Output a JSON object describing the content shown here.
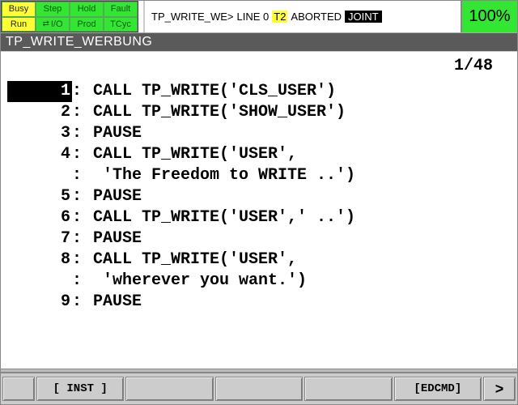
{
  "status": {
    "cells": [
      {
        "label": "Busy",
        "cls": "status-yellow"
      },
      {
        "label": "Step",
        "cls": "status-green"
      },
      {
        "label": "Hold",
        "cls": "status-green"
      },
      {
        "label": "Fault",
        "cls": "status-green"
      },
      {
        "label": "Run",
        "cls": "status-yellow"
      },
      {
        "label": "I/O",
        "cls": "status-green",
        "io": true
      },
      {
        "label": "Prod",
        "cls": "status-green"
      },
      {
        "label": "TCyc",
        "cls": "status-green"
      }
    ],
    "msg_prefix": "TP_WRITE_WE",
    "msg_line": "LINE 0",
    "msg_t2": "T2",
    "msg_state": "ABORTED",
    "msg_joint": "JOINT",
    "override": "100%"
  },
  "title": "TP_WRITE_WERBUNG",
  "counter": "1/48",
  "lines": [
    {
      "n": "1",
      "sel": true,
      "txt": "CALL TP_WRITE('CLS_USER')"
    },
    {
      "n": "2",
      "txt": "CALL TP_WRITE('SHOW_USER')"
    },
    {
      "n": "3",
      "txt": "PAUSE"
    },
    {
      "n": "4",
      "txt": "CALL TP_WRITE('USER',"
    },
    {
      "n": "",
      "cont": true,
      "txt": "'The Freedom to WRITE ..')"
    },
    {
      "n": "5",
      "txt": "PAUSE"
    },
    {
      "n": "6",
      "txt": "CALL TP_WRITE('USER',' ..')"
    },
    {
      "n": "7",
      "txt": "PAUSE"
    },
    {
      "n": "8",
      "txt": "CALL TP_WRITE('USER',"
    },
    {
      "n": "",
      "cont": true,
      "txt": "'wherever you want.')"
    },
    {
      "n": "9",
      "txt": "PAUSE"
    }
  ],
  "footer": {
    "f0": "",
    "f1": "[ INST ]",
    "f2": "",
    "f3": "",
    "f4": "",
    "f5": "[EDCMD]",
    "next": ">"
  }
}
